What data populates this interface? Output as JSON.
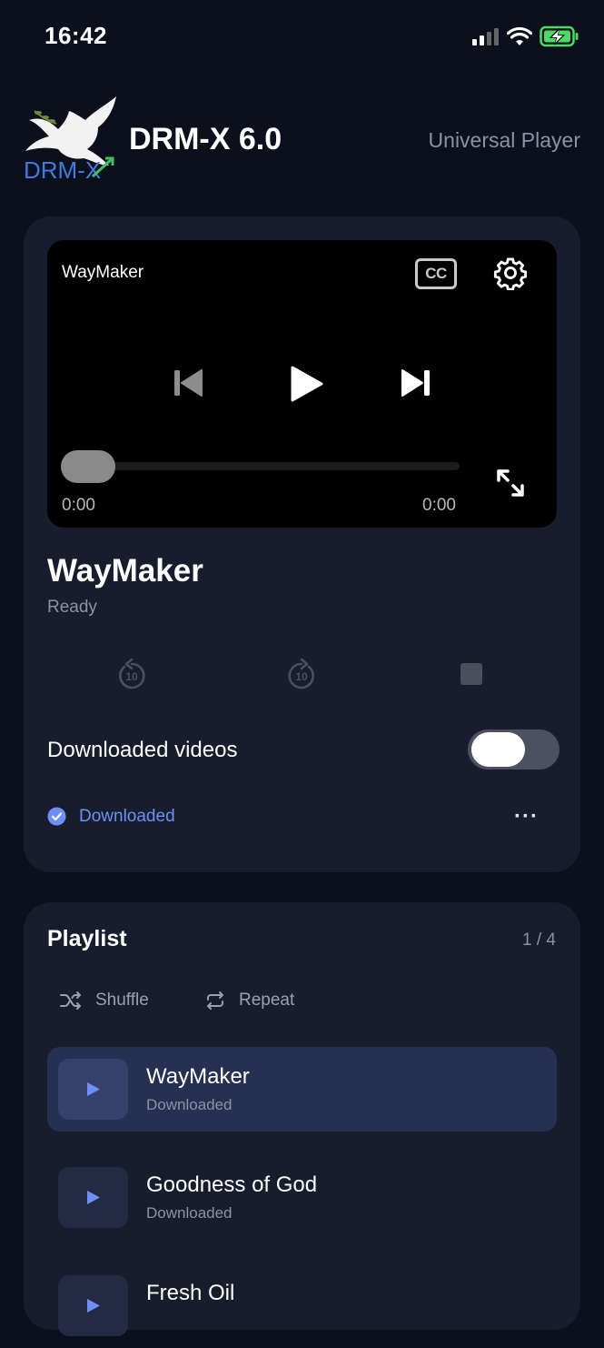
{
  "status_bar": {
    "time": "16:42"
  },
  "header": {
    "logo_text": "DRM-X",
    "title": "DRM-X 6.0",
    "subtitle": "Universal Player"
  },
  "player": {
    "video_title": "WayMaker",
    "cc_label": "CC",
    "current_time": "0:00",
    "duration": "0:00",
    "progress": 0
  },
  "now_playing": {
    "title": "WayMaker",
    "status": "Ready"
  },
  "skip_back_label": "10",
  "skip_forward_label": "10",
  "downloads": {
    "toggle_label": "Downloaded videos",
    "toggle_on": false,
    "badge": "Downloaded",
    "more_label": "···"
  },
  "playlist": {
    "title": "Playlist",
    "count": "1 / 4",
    "shuffle_label": "Shuffle",
    "repeat_label": "Repeat",
    "items": [
      {
        "title": "WayMaker",
        "subtitle": "Downloaded",
        "active": true
      },
      {
        "title": "Goodness of God",
        "subtitle": "Downloaded",
        "active": false
      },
      {
        "title": "Fresh Oil",
        "subtitle": "",
        "active": false
      }
    ]
  },
  "colors": {
    "background": "#0c101c",
    "card": "#181d2d",
    "accent": "#6e8ff5",
    "active_row": "#263052"
  }
}
